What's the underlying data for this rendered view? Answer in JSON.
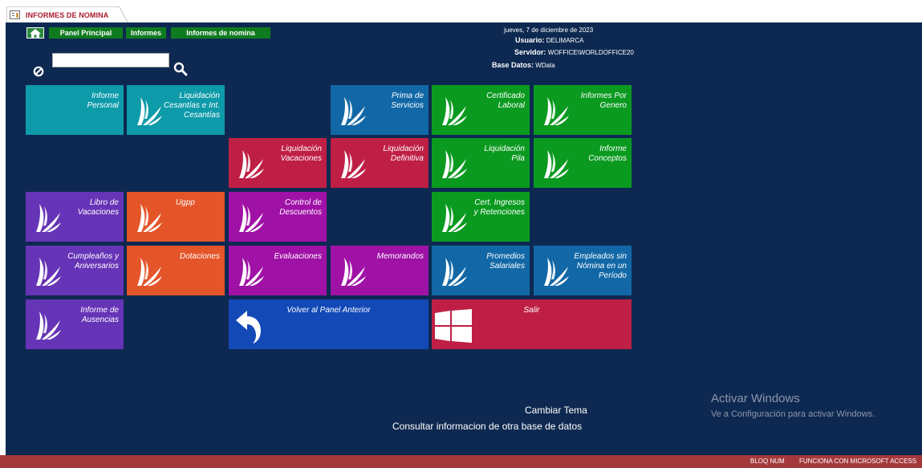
{
  "document_tab": {
    "title": "INFORMES DE NOMINA",
    "icon": "form-icon"
  },
  "nav": {
    "home_icon": "home-icon",
    "items": [
      "Panel Principal",
      "Informes",
      "Informes de nomina"
    ]
  },
  "info": {
    "date": "jueves, 7 de diciembre de 2023",
    "usuario_label": "Usuario:",
    "usuario_value": "DELIMARCA",
    "servidor_label": "Servidor:",
    "servidor_value": "WOFFICE\\WORLDOFFICE20",
    "base_label": "Base Datos:",
    "base_value": "WData"
  },
  "search": {
    "value": "",
    "clear_icon": "clear-icon",
    "search_icon": "search-icon"
  },
  "tiles": {
    "informe_personal": "Informe\nPersonal",
    "liquidacion_cesantias": "Liquidación\nCesantías e Int.\nCesantías",
    "prima_servicios": "Prima de\nServicios",
    "certificado_laboral": "Certificado\nLaboral",
    "informes_genero": "Informes Por\nGenero",
    "liquidacion_vacaciones": "Liquidación\nVacaciones",
    "liquidacion_definitiva": "Liquidación\nDefinitiva",
    "liquidacion_pila": "Liquidación\nPila",
    "informe_conceptos": "Informe\nConceptos",
    "libro_vacaciones": "Libro de\nVacaciones",
    "ugpp": "Ugpp",
    "control_descuentos": "Control de\nDescuentos",
    "cert_ingresos": "Cert. Ingresos\ny Retenciones",
    "cumpleanos": "Cumpleaños y\nAniversarios",
    "dotaciones": "Dotaciones",
    "evaluaciones": "Evaluaciones",
    "memorandos": "Memorandos",
    "promedios_salariales": "Promedios\nSalariales",
    "empleados_sin_nomina": "Empleados sin\nNómina en un\nPeríodo",
    "informe_ausencias": "Informe de\nAusencias",
    "volver": "Volver al Panel Anterior",
    "salir": "Salir"
  },
  "tile_icons": {
    "default": "worldoffice-logo-icon",
    "volver": "back-arrow-icon",
    "salir": "windows-logo-icon"
  },
  "colors": {
    "background": "#0e2951",
    "teal": "#0d9aa9",
    "blue": "#1268a6",
    "green": "#0b9a20",
    "crimson": "#bf1f45",
    "purple": "#6634b6",
    "orange": "#e4552a",
    "magenta": "#a012a6",
    "navy": "#1349b7",
    "statusbar": "#a4393c"
  },
  "bottom_links": {
    "cambiar_tema": "Cambiar Tema",
    "consultar": "Consultar informacion de otra base de datos"
  },
  "watermark": {
    "title": "Activar Windows",
    "subtitle": "Ve a Configuración para activar Windows."
  },
  "statusbar": {
    "bloq_num": "BLOQ NUM",
    "funciona": "FUNCIONA CON MICROSOFT ACCESS"
  }
}
